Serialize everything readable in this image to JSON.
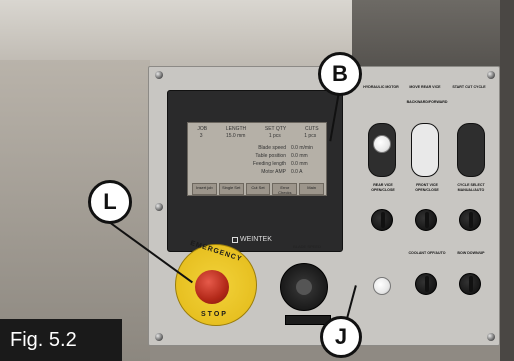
{
  "figure": {
    "label": "Fig. 5.2"
  },
  "callouts": {
    "b": "B",
    "l": "L",
    "j": "J"
  },
  "hmi": {
    "headers": [
      "JOB",
      "LENGTH",
      "SET QTY",
      "CUTS"
    ],
    "values": [
      "3",
      "15.0 mm",
      "1 pcs",
      "1 pcs"
    ],
    "rows": [
      {
        "label": "Blade speed",
        "value": "0.0 m/min"
      },
      {
        "label": "Table position",
        "value": "0.0 mm"
      },
      {
        "label": "Feeding length",
        "value": "0.0 mm"
      },
      {
        "label": "Motor AMP",
        "value": "0.0 A"
      }
    ],
    "buttons": [
      "Insert job",
      "Single Set",
      "Cut Set",
      "Error Checks",
      "Main"
    ],
    "brand": "WEINTEK"
  },
  "emergency_stop": {
    "top_text": "EMERGENCY",
    "bottom_text": "STOP"
  },
  "blade_speed": {
    "label": "BLADE SPEED"
  },
  "controls": {
    "hydraulic_motor": "HYDRAULIC MOTOR",
    "move_rear_vice": "MOVE REAR VICE",
    "backward_forward": "BACKWARD/FORWARD",
    "start_cut_cycle": "START CUT CYCLE",
    "rear_vice": "REAR VICE OPEN/CLOSE",
    "front_vice": "FRONT VICE OPEN/CLOSE",
    "cycle_select": "CYCLE SELECT MANUAL/AUTO",
    "coolant": "COOLANT OFF/AUTO",
    "bow": "BOW DOWN/UP"
  }
}
